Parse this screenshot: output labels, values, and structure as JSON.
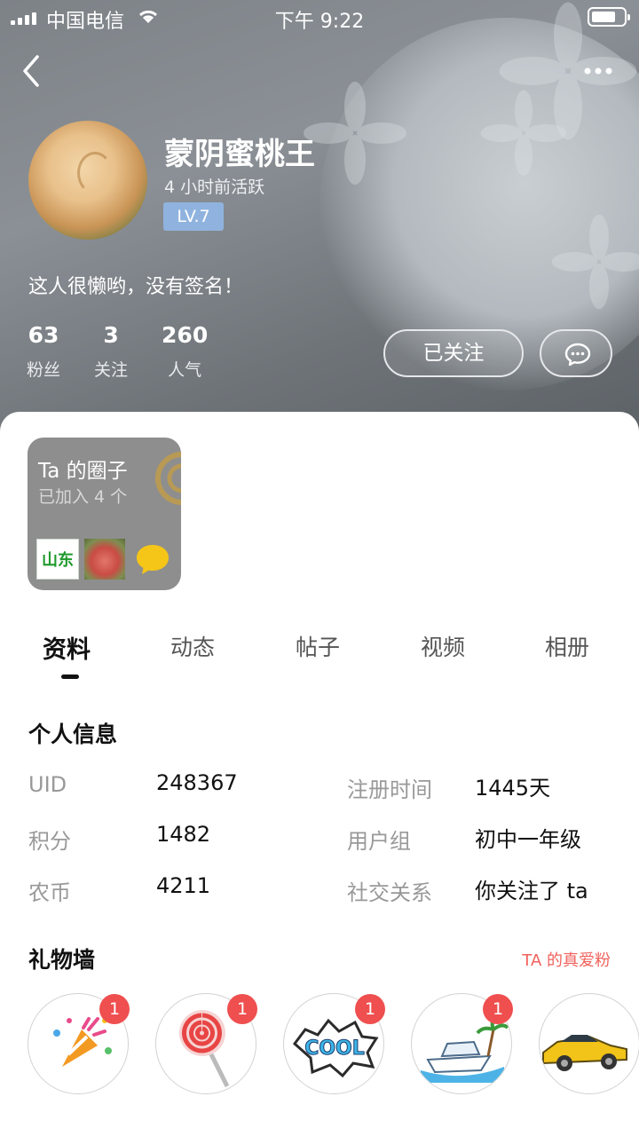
{
  "status_bar": {
    "carrier": "中国电信",
    "time": "下午 9:22"
  },
  "profile": {
    "name": "蒙阴蜜桃王",
    "last_active": "4 小时前活跃",
    "level": "LV.7",
    "signature": "这人很懒哟，没有签名！",
    "stats": [
      {
        "value": "63",
        "label": "粉丝"
      },
      {
        "value": "3",
        "label": "关注"
      },
      {
        "value": "260",
        "label": "人气"
      }
    ],
    "follow_label": "已关注"
  },
  "circles": {
    "title": "Ta 的圈子",
    "subtitle": "已加入 4 个",
    "thumb_text": "山东"
  },
  "tabs": [
    "资料",
    "动态",
    "帖子",
    "视频",
    "相册"
  ],
  "active_tab": "资料",
  "personal_info": {
    "title": "个人信息",
    "rows": [
      {
        "k1": "UID",
        "v1": "248367",
        "k2": "注册时间",
        "v2": "1445天"
      },
      {
        "k1": "积分",
        "v1": "1482",
        "k2": "用户组",
        "v2": "初中一年级"
      },
      {
        "k1": "农币",
        "v1": "4211",
        "k2": "社交关系",
        "v2": "你关注了 ta"
      }
    ]
  },
  "gift_wall": {
    "title": "礼物墙",
    "link": "TA 的真爱粉",
    "gifts": [
      {
        "icon": "party-popper-icon",
        "count": "1"
      },
      {
        "icon": "lollipop-icon",
        "count": "1"
      },
      {
        "icon": "cool-sticker-icon",
        "count": "1"
      },
      {
        "icon": "yacht-icon",
        "count": "1"
      },
      {
        "icon": "sports-car-icon",
        "count": ""
      }
    ]
  },
  "colors": {
    "accent_red": "#ef4f4f",
    "level_badge": "#8fb3de",
    "header_gray": "#7d8287"
  }
}
